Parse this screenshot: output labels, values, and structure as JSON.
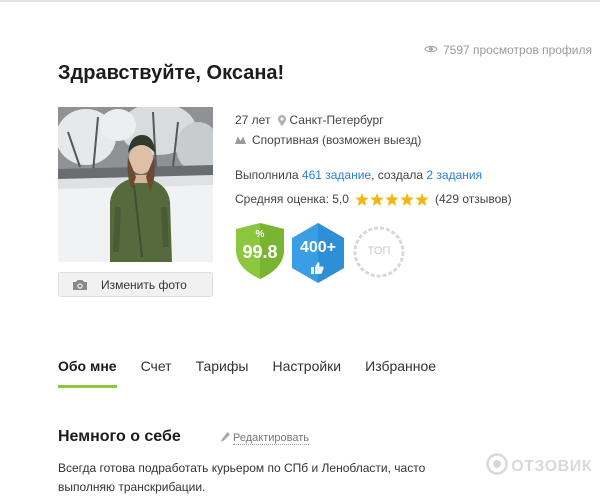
{
  "header": {
    "views_text": "7597 просмотров профиля",
    "greeting": "Здравствуйте, Оксана!"
  },
  "photo": {
    "change_label": "Изменить фото"
  },
  "profile": {
    "age": "27 лет",
    "city": "Санкт-Петербург",
    "metro": "Спортивная (возможен выезд)",
    "completed_prefix": "Выполнила",
    "completed_link": "461 задание",
    "created_prefix": ", создала",
    "created_link": "2 задания",
    "rating_label": "Средняя оценка: 5,0",
    "rating_stars": 5,
    "reviews": "(429 отзывов)"
  },
  "badges": {
    "percent_symbol": "%",
    "percent_value": "99.8",
    "reviews_badge": "400+",
    "top_badge": "ТОП"
  },
  "tabs": [
    {
      "label": "Обо мне",
      "active": true
    },
    {
      "label": "Счет",
      "active": false
    },
    {
      "label": "Тарифы",
      "active": false
    },
    {
      "label": "Настройки",
      "active": false
    },
    {
      "label": "Избранное",
      "active": false
    }
  ],
  "about": {
    "title": "Немного о себе",
    "edit_label": "Редактировать",
    "text": "Всегда готова подработать курьером по СПб и Ленобласти, часто выполняю транскрибации."
  },
  "watermark": {
    "text": "ОТЗОВИК"
  },
  "colors": {
    "link": "#2a7fd0",
    "star": "#f5b50f",
    "tab_active": "#8dc63f",
    "shield_green": "#8dc63f",
    "hex_blue": "#3a9ee4"
  },
  "icons": [
    "eye-icon",
    "camera-icon",
    "location-pin-icon",
    "metro-icon",
    "star-icon",
    "pencil-icon",
    "thumbs-up-icon",
    "watermark-logo-icon"
  ]
}
